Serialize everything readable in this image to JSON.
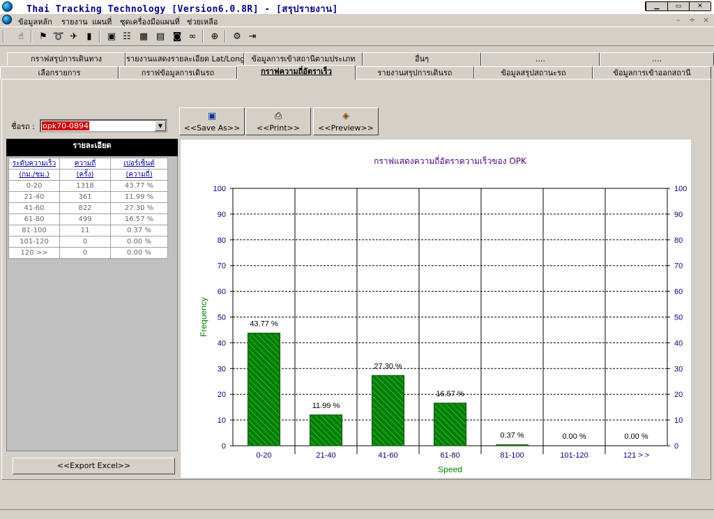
{
  "window": {
    "title": "Thai Tracking Technology [Version6.0.8R] - [สรุปรายงาน]",
    "controls": [
      "▁",
      "▭",
      "✕"
    ]
  },
  "menu": {
    "items": [
      "ข้อมูลหลัก",
      "รายงาน",
      "แผนที่",
      "ชุดเครื่องมือแผนที่",
      "ช่วยเหลือ"
    ],
    "mdi_controls": [
      "–",
      "÷",
      "×"
    ]
  },
  "toolbar": {
    "icons": [
      "hand-icon",
      "find-vehicle-icon",
      "track-icon",
      "route-icon",
      "report-icon",
      "monitor-icon",
      "list-icon",
      "chart-icon",
      "document-icon",
      "camera-icon",
      "binoculars-icon",
      "zoom-icon",
      "settings-icon",
      "exit-icon"
    ]
  },
  "tabs_row1": [
    "กราฟสรุปการเดินทาง",
    "รายงานแสดงรายละเอียด Lat/Long",
    "ข้อมูลการเข้าสถานีตามประเภท",
    "อื่นๆ",
    "....",
    "...."
  ],
  "tabs_row2": [
    "เลือกรายการ",
    "กราฟข้อมูลการเดินรถ",
    "กราฟความถี่อัตราเร็ว",
    "รายงานสรุปการเดินรถ",
    "ข้อมูลสรุปสถานะรถ",
    "ข้อมูลการเข้าออกสถานี"
  ],
  "active_tab": "กราฟความถี่อัตราเร็ว",
  "vehicle": {
    "label": "ชื่อรถ :",
    "value": "opk70-0894"
  },
  "buttons": {
    "save": "<<Save As>>",
    "print": "<<Print>>",
    "preview": "<<Preview>>",
    "export": "<<Export Excel>>"
  },
  "details": {
    "header": "รายละเอียด",
    "columns": [
      [
        "ระดับความเร็ว",
        "(กม./ชม.)"
      ],
      [
        "ความถี่",
        "(ครั้ง)"
      ],
      [
        "เปอร์เซ็นต์",
        "(ความถี่)"
      ]
    ],
    "rows": [
      [
        "0-20",
        "1318",
        "43.77 %"
      ],
      [
        "21-40",
        "361",
        "11.99 %"
      ],
      [
        "41-60",
        "822",
        "27.30 %"
      ],
      [
        "61-80",
        "499",
        "16.57 %"
      ],
      [
        "81-100",
        "11",
        "0.37 %"
      ],
      [
        "101-120",
        "0",
        "0.00 %"
      ],
      [
        "120 >>",
        "0",
        "0.00 %"
      ]
    ]
  },
  "chart_data": {
    "type": "bar",
    "title": "กราฟแสดงความถี่อัตราความเร็วของ OPK",
    "xlabel": "Speed",
    "ylabel": "Frequency",
    "categories": [
      "0-20",
      "21-40",
      "41-60",
      "61-80",
      "81-100",
      "101-120",
      "121 > >"
    ],
    "values": [
      43.77,
      11.99,
      27.3,
      16.57,
      0.37,
      0.0,
      0.0
    ],
    "data_labels": [
      "43.77 %",
      "11.99 %",
      "27.30 %",
      "16.57 %",
      "0.37 %",
      "0.00 %",
      "0.00 %"
    ],
    "ylim": [
      0,
      100
    ],
    "yticks": [
      0,
      10,
      20,
      30,
      40,
      50,
      60,
      70,
      80,
      90,
      100
    ],
    "grid": true,
    "colors": {
      "bar": "#008000",
      "title": "#4b0082",
      "axis_label": "#008000",
      "tick": "#000080"
    }
  }
}
